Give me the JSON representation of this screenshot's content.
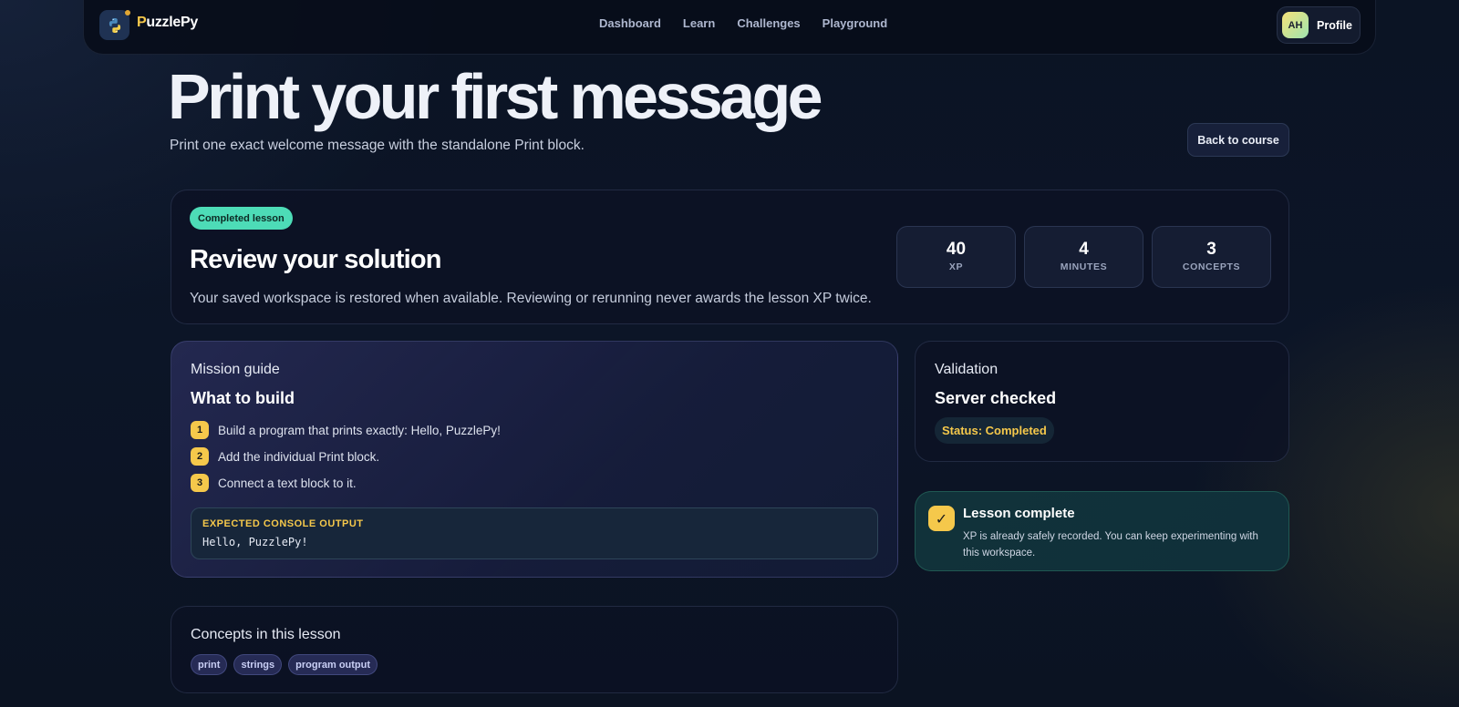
{
  "nav": {
    "brand": {
      "name_first": "P",
      "name_rest": "uzzlePy",
      "icon": "python-logo-icon"
    },
    "links": [
      "Dashboard",
      "Learn",
      "Challenges",
      "Playground"
    ],
    "profile": {
      "initials": "AH",
      "label": "Profile"
    }
  },
  "header": {
    "title": "Print your first message",
    "subtitle": "Print one exact welcome message with the standalone Print block.",
    "back_label": "Back to course"
  },
  "review": {
    "badge": "Completed lesson",
    "title": "Review your solution",
    "description": "Your saved workspace is restored when available. Reviewing or rerunning never awards the lesson XP twice.",
    "stats": [
      {
        "value": "40",
        "label": "XP"
      },
      {
        "value": "4",
        "label": "MINUTES"
      },
      {
        "value": "3",
        "label": "CONCEPTS"
      }
    ]
  },
  "mission": {
    "kicker": "Mission guide",
    "heading": "What to build",
    "steps": [
      {
        "num": "1",
        "text": "Build a program that prints exactly: Hello, PuzzlePy!"
      },
      {
        "num": "2",
        "text": "Add the individual Print block."
      },
      {
        "num": "3",
        "text": "Connect a text block to it."
      }
    ],
    "output_label": "EXPECTED CONSOLE OUTPUT",
    "output_code": "Hello, PuzzlePy!"
  },
  "validation": {
    "kicker": "Validation",
    "heading": "Server checked",
    "status": "Status: Completed"
  },
  "complete": {
    "title": "Lesson complete",
    "text": "XP is already safely recorded. You can keep experimenting with this workspace.",
    "icon": "checkmark-icon"
  },
  "concepts": {
    "kicker": "Concepts in this lesson",
    "chips": [
      "print",
      "strings",
      "program output"
    ]
  },
  "colors": {
    "accent_yellow": "#f5c84b",
    "badge_green": "#4ddcb7",
    "background": "#0c1527"
  }
}
